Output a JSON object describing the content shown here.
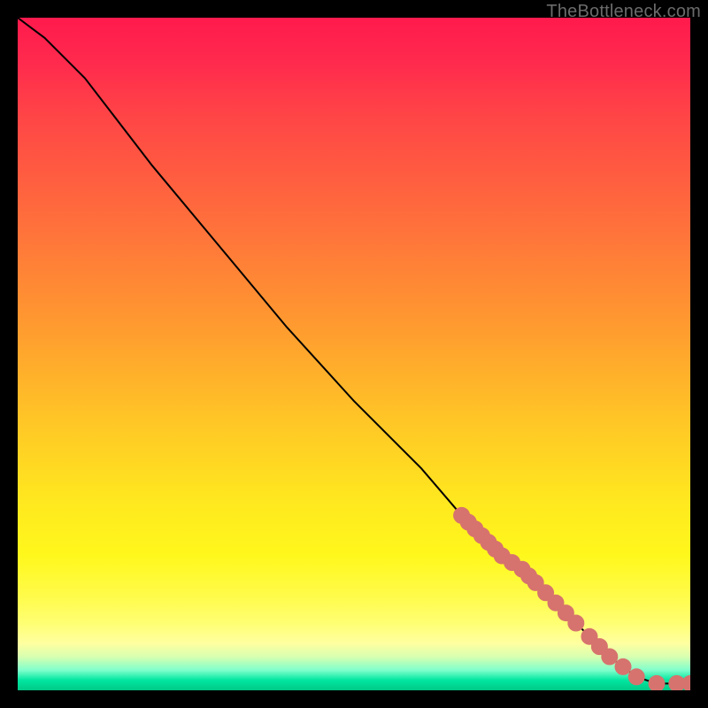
{
  "watermark": "TheBottleneck.com",
  "chart_data": {
    "type": "line",
    "title": "",
    "xlabel": "",
    "ylabel": "",
    "xlim": [
      0,
      100
    ],
    "ylim": [
      0,
      100
    ],
    "grid": false,
    "curve": [
      {
        "x": 0,
        "y": 100
      },
      {
        "x": 4,
        "y": 97
      },
      {
        "x": 8,
        "y": 93
      },
      {
        "x": 10,
        "y": 91
      },
      {
        "x": 20,
        "y": 78
      },
      {
        "x": 30,
        "y": 66
      },
      {
        "x": 40,
        "y": 54
      },
      {
        "x": 50,
        "y": 43
      },
      {
        "x": 60,
        "y": 33
      },
      {
        "x": 66,
        "y": 26
      },
      {
        "x": 70,
        "y": 22
      },
      {
        "x": 75,
        "y": 18
      },
      {
        "x": 80,
        "y": 13
      },
      {
        "x": 84,
        "y": 9
      },
      {
        "x": 88,
        "y": 5
      },
      {
        "x": 92,
        "y": 2
      },
      {
        "x": 95,
        "y": 1
      },
      {
        "x": 98,
        "y": 1
      },
      {
        "x": 100,
        "y": 1
      }
    ],
    "markers": [
      {
        "x": 66,
        "y": 26
      },
      {
        "x": 67,
        "y": 25
      },
      {
        "x": 68,
        "y": 24
      },
      {
        "x": 69,
        "y": 23
      },
      {
        "x": 70,
        "y": 22
      },
      {
        "x": 71,
        "y": 21
      },
      {
        "x": 72,
        "y": 20
      },
      {
        "x": 73.5,
        "y": 19
      },
      {
        "x": 75,
        "y": 18
      },
      {
        "x": 76,
        "y": 17
      },
      {
        "x": 77,
        "y": 16
      },
      {
        "x": 78.5,
        "y": 14.5
      },
      {
        "x": 80,
        "y": 13
      },
      {
        "x": 81.5,
        "y": 11.5
      },
      {
        "x": 83,
        "y": 10
      },
      {
        "x": 85,
        "y": 8
      },
      {
        "x": 86.5,
        "y": 6.5
      },
      {
        "x": 88,
        "y": 5
      },
      {
        "x": 90,
        "y": 3.5
      },
      {
        "x": 92,
        "y": 2
      },
      {
        "x": 95,
        "y": 1
      },
      {
        "x": 98,
        "y": 1
      },
      {
        "x": 100,
        "y": 1
      }
    ],
    "gradient_colors": {
      "top": "#ff1a4d",
      "mid_upper": "#ff8030",
      "mid": "#ffe81f",
      "lower_band": "#ffffa0",
      "bottom": "#00c986"
    }
  }
}
